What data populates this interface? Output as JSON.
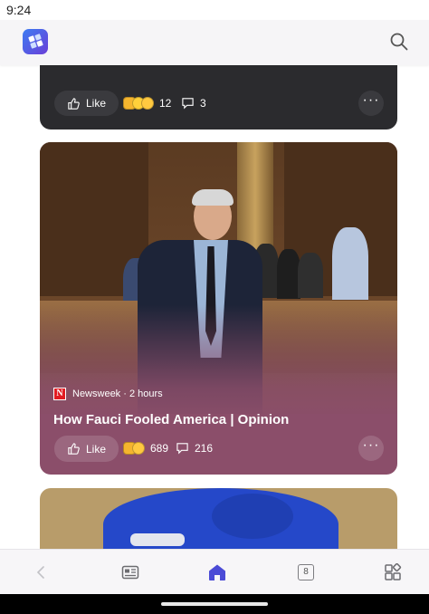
{
  "status_bar": {
    "time": "9:24"
  },
  "header": {
    "app_icon": "app-logo-icon",
    "search_icon": "search-icon"
  },
  "cards": [
    {
      "like_label": "Like",
      "reaction_count": "12",
      "comment_count": "3",
      "theme_color": "#2b2b2e"
    },
    {
      "source": "Newsweek",
      "source_logo_letter": "N",
      "age": "2 hours",
      "separator": "·",
      "headline": "How Fauci Fooled America | Opinion",
      "like_label": "Like",
      "reaction_count": "689",
      "comment_count": "216",
      "theme_color": "#8b4e6a"
    },
    {
      "theme_color": "#b89c6a"
    }
  ],
  "bottom_nav": {
    "items": [
      "back-icon",
      "news-icon",
      "home-icon",
      "tabs-icon",
      "apps-icon"
    ],
    "tab_count": "8",
    "active_color": "#4b4bd6"
  }
}
